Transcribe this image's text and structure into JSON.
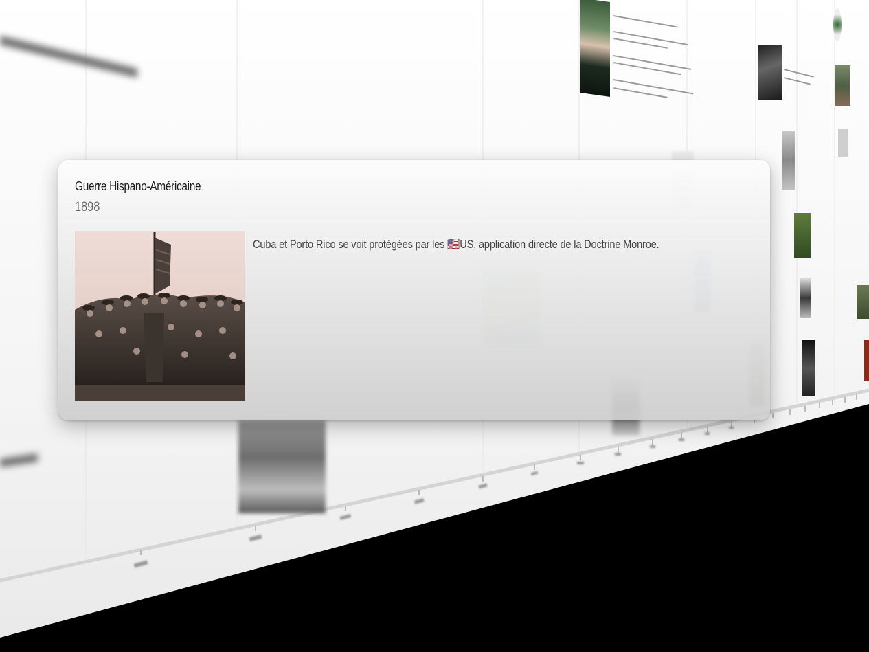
{
  "event": {
    "title": "Guerre Hispano-Américaine",
    "year": "1898",
    "description_before_flag": "Cuba et Porto Rico se voit protégées par les ",
    "flag": "🇺🇸",
    "description_after_flag": "US, application directe de la Doctrine Monroe.",
    "photo_icon": "soldiers-photo"
  },
  "colors": {
    "background": "#000000",
    "wall": "#f4f4f4",
    "card": "#e6e6e6",
    "title": "#1d1d1d",
    "year": "#6a6a6a",
    "description": "#444444"
  }
}
